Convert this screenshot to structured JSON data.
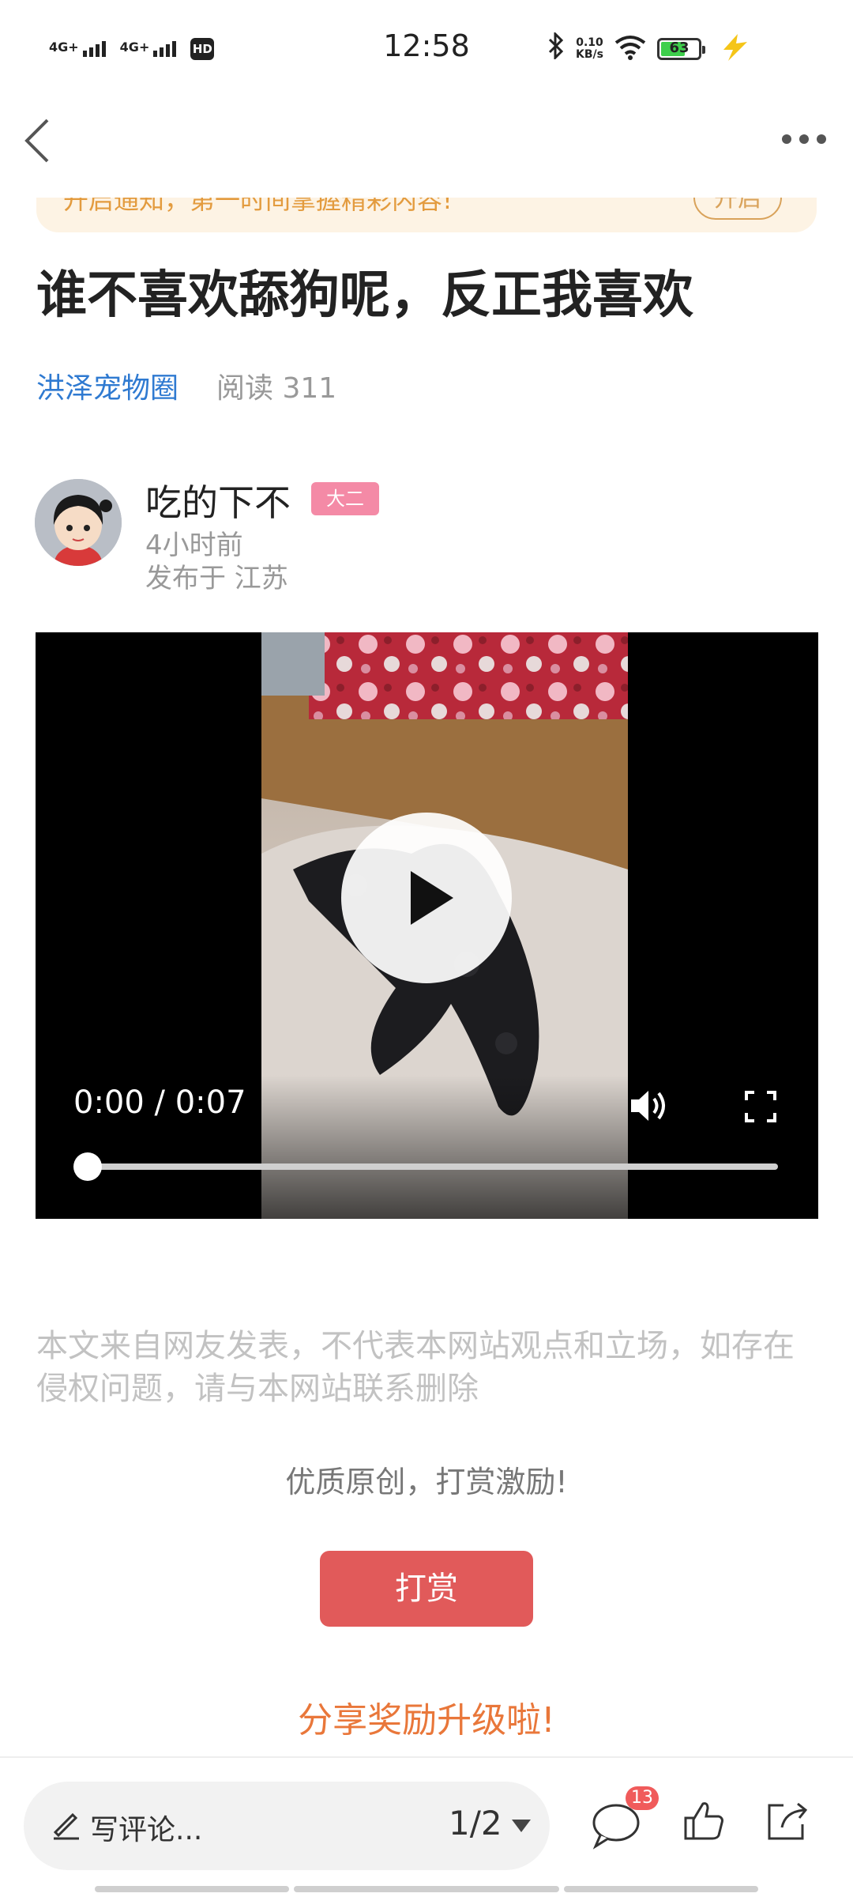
{
  "status_bar": {
    "signal1": "4G+",
    "signal2": "4G+",
    "hd": "HD",
    "time": "12:58",
    "net_speed_value": "0.10",
    "net_speed_unit": "KB/s",
    "battery": "63"
  },
  "notice": {
    "text": "开启通知，第一时间掌握精彩内容!",
    "button": "开启"
  },
  "article": {
    "title": "谁不喜欢舔狗呢，反正我喜欢",
    "circle": "洪泽宠物圈",
    "reads": "阅读 311"
  },
  "author": {
    "name": "吃的下不",
    "badge": "大二",
    "time": "4小时前",
    "location": "发布于 江苏"
  },
  "video": {
    "time": "0:00 / 0:07",
    "progress": 0
  },
  "disclaimer": "本文来自网友发表，不代表本网站观点和立场，如存在侵权问题，请与本网站联系删除",
  "reward": {
    "prompt": "优质原创，打赏激励!",
    "button": "打赏",
    "share_reward": "分享奖励升级啦!"
  },
  "bottom_bar": {
    "comment_placeholder": "写评论...",
    "pager": "1/2",
    "comment_count": "13"
  },
  "icons": [
    "bluetooth-icon",
    "wifi-icon",
    "battery-icon",
    "charging-icon",
    "back-icon",
    "more-icon",
    "play-icon",
    "volume-icon",
    "fullscreen-icon",
    "pen-icon",
    "comment-icon",
    "like-icon",
    "share-icon"
  ]
}
